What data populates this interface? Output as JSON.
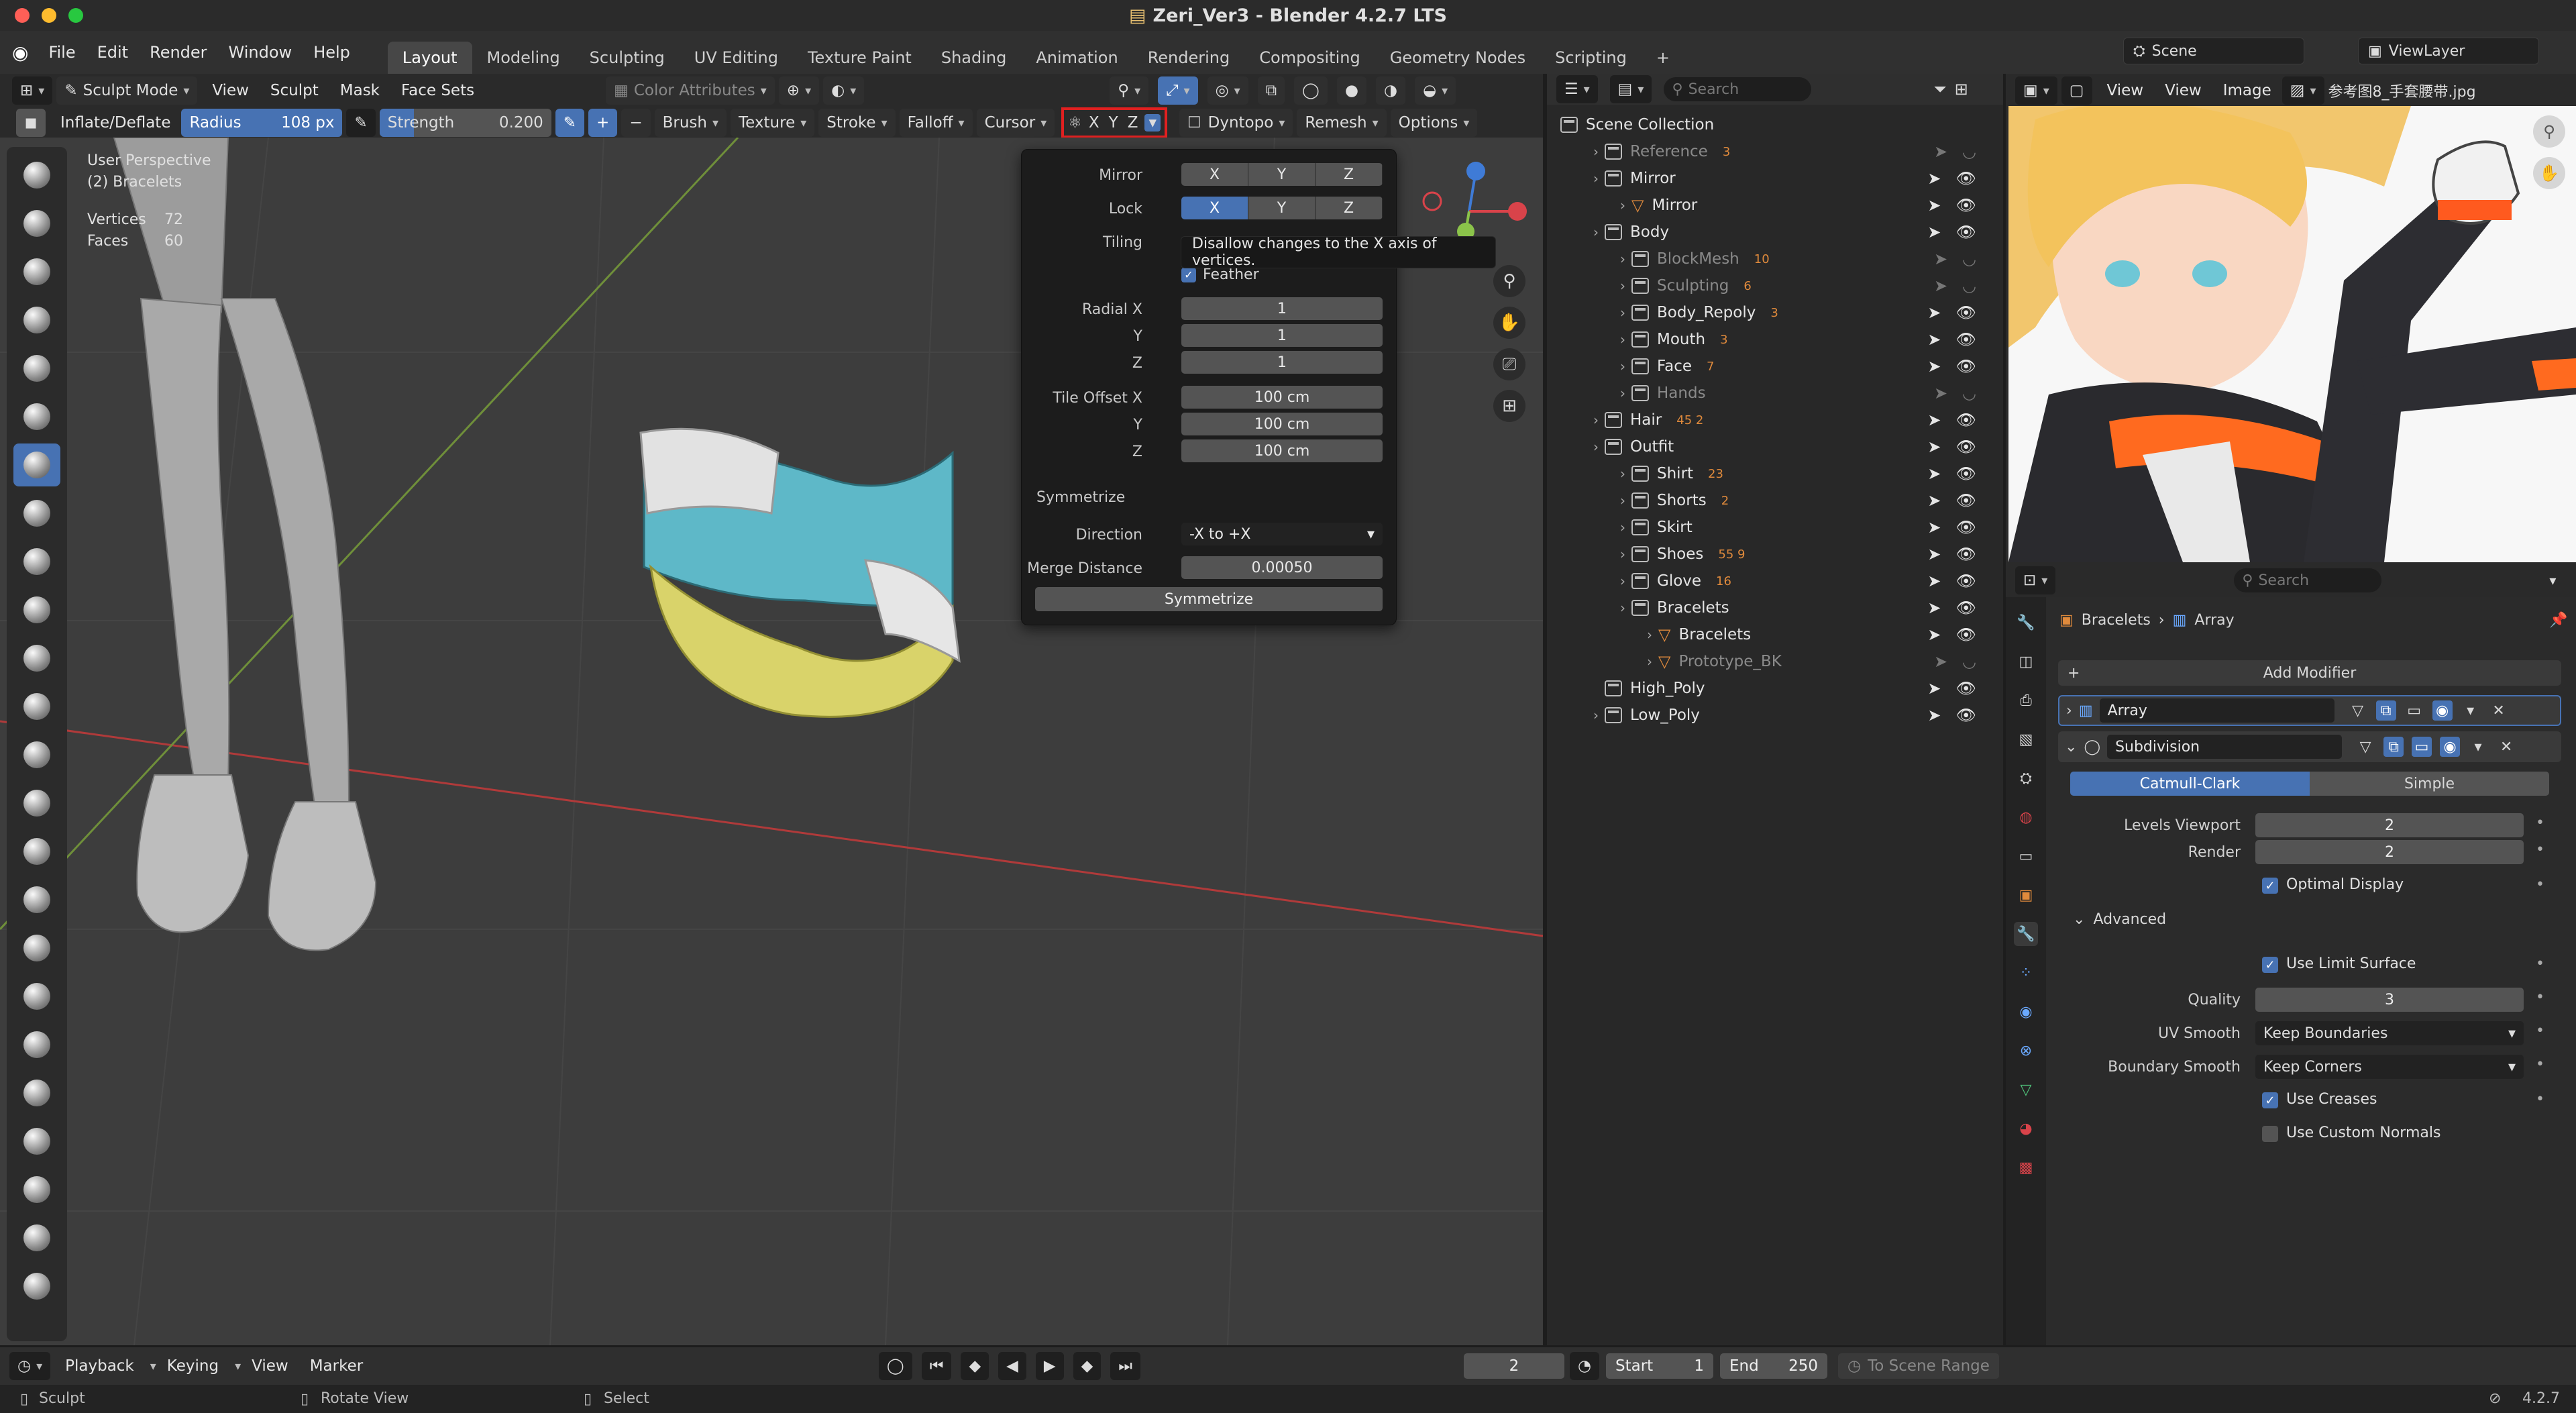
{
  "window": {
    "title": "Zeri_Ver3 - Blender 4.2.7 LTS"
  },
  "menu": {
    "items": [
      "File",
      "Edit",
      "Render",
      "Window",
      "Help"
    ]
  },
  "workspaces": [
    "Layout",
    "Modeling",
    "Sculpting",
    "UV Editing",
    "Texture Paint",
    "Shading",
    "Animation",
    "Rendering",
    "Compositing",
    "Geometry Nodes",
    "Scripting"
  ],
  "scene": {
    "name": "Scene",
    "view_layer": "ViewLayer"
  },
  "viewport_header": {
    "mode": "Sculpt Mode",
    "menus": [
      "View",
      "Sculpt",
      "Mask",
      "Face Sets"
    ],
    "color_attributes": "Color Attributes"
  },
  "tool_header": {
    "brush": "Inflate/Deflate",
    "radius_label": "Radius",
    "radius_value": "108 px",
    "strength_label": "Strength",
    "strength_value": "0.200",
    "dropdowns": [
      "Brush",
      "Texture",
      "Stroke",
      "Falloff",
      "Cursor"
    ],
    "axes": [
      "X",
      "Y",
      "Z"
    ],
    "dyntopo": "Dyntopo",
    "remesh": "Remesh",
    "options": "Options"
  },
  "viewport_info": {
    "perspective": "User Perspective",
    "object": "(2) Bracelets",
    "vertices_label": "Vertices",
    "vertices": "72",
    "faces_label": "Faces",
    "faces": "60"
  },
  "popup": {
    "mirror_label": "Mirror",
    "lock_label": "Lock",
    "tiling_label": "Tiling",
    "feather_label": "Feather",
    "axes": [
      "X",
      "Y",
      "Z"
    ],
    "radial_x_label": "Radial X",
    "radial_x": "1",
    "y_label": "Y",
    "radial_y": "1",
    "z_label": "Z",
    "radial_z": "1",
    "tile_offset_label": "Tile Offset X",
    "tile_x": "100 cm",
    "tile_y": "100 cm",
    "tile_z": "100 cm",
    "symmetrize_title": "Symmetrize",
    "direction_label": "Direction",
    "direction": "-X to +X",
    "merge_label": "Merge Distance",
    "merge": "0.00050",
    "symmetrize_button": "Symmetrize"
  },
  "tooltip": "Disallow changes to the X axis of vertices.",
  "outliner": {
    "search_placeholder": "Search",
    "rows": [
      {
        "name": "Scene Collection",
        "level": 0,
        "type": "root"
      },
      {
        "name": "Reference",
        "level": 1,
        "type": "col",
        "dim": true,
        "badge": "3"
      },
      {
        "name": "Mirror",
        "level": 1,
        "type": "col"
      },
      {
        "name": "Mirror",
        "level": 2,
        "type": "obj"
      },
      {
        "name": "Body",
        "level": 1,
        "type": "col"
      },
      {
        "name": "BlockMesh",
        "level": 2,
        "type": "col",
        "dim": true,
        "badge": "10"
      },
      {
        "name": "Sculpting",
        "level": 2,
        "type": "col",
        "dim": true,
        "badge": "6"
      },
      {
        "name": "Body_Repoly",
        "level": 2,
        "type": "col",
        "badge": "3"
      },
      {
        "name": "Mouth",
        "level": 2,
        "type": "col",
        "badge": "3"
      },
      {
        "name": "Face",
        "level": 2,
        "type": "col",
        "badge": "7"
      },
      {
        "name": "Hands",
        "level": 2,
        "type": "col",
        "dim": true
      },
      {
        "name": "Hair",
        "level": 1,
        "type": "col",
        "badge": "45 2"
      },
      {
        "name": "Outfit",
        "level": 1,
        "type": "col"
      },
      {
        "name": "Shirt",
        "level": 2,
        "type": "col",
        "badge": "23"
      },
      {
        "name": "Shorts",
        "level": 2,
        "type": "col",
        "badge": "2"
      },
      {
        "name": "Skirt",
        "level": 2,
        "type": "col"
      },
      {
        "name": "Shoes",
        "level": 2,
        "type": "col",
        "badge": "55 9"
      },
      {
        "name": "Glove",
        "level": 2,
        "type": "col",
        "badge": "16"
      },
      {
        "name": "Bracelets",
        "level": 2,
        "type": "col"
      },
      {
        "name": "Bracelets",
        "level": 3,
        "type": "obj"
      },
      {
        "name": "Prototype_BK",
        "level": 3,
        "type": "obj",
        "dim": true
      },
      {
        "name": "High_Poly",
        "level": 1,
        "type": "col"
      },
      {
        "name": "Low_Poly",
        "level": 1,
        "type": "col"
      }
    ]
  },
  "image_editor": {
    "menus": [
      "View",
      "View",
      "Image"
    ],
    "image_name": "参考图8_手套腰带.jpg"
  },
  "properties": {
    "search_placeholder": "Search",
    "breadcrumb_object": "Bracelets",
    "breadcrumb_modifier": "Array",
    "add_modifier": "Add Modifier",
    "modifier1": "Array",
    "modifier2": "Subdivision",
    "catmull": "Catmull-Clark",
    "simple": "Simple",
    "levels_viewport_label": "Levels Viewport",
    "levels_viewport": "2",
    "render_label": "Render",
    "render": "2",
    "optimal_display": "Optimal Display",
    "advanced": "Advanced",
    "use_limit_surface": "Use Limit Surface",
    "quality_label": "Quality",
    "quality": "3",
    "uv_smooth_label": "UV Smooth",
    "uv_smooth": "Keep Boundaries",
    "boundary_smooth_label": "Boundary Smooth",
    "boundary_smooth": "Keep Corners",
    "use_creases": "Use Creases",
    "use_custom_normals": "Use Custom Normals"
  },
  "timeline": {
    "playback": "Playback",
    "keying": "Keying",
    "view": "View",
    "marker": "Marker",
    "current_frame": "2",
    "start_label": "Start",
    "start": "1",
    "end_label": "End",
    "end": "250",
    "to_scene_range": "To Scene Range"
  },
  "status": {
    "sculpt": "Sculpt",
    "rotate_view": "Rotate View",
    "select": "Select",
    "version": "4.2.7"
  },
  "colors": {
    "accent": "#4772b3",
    "highlight_red": "#e02020",
    "x_axis": "#d9434a",
    "y_axis": "#8bc34a",
    "z_axis": "#3f7bd6"
  }
}
